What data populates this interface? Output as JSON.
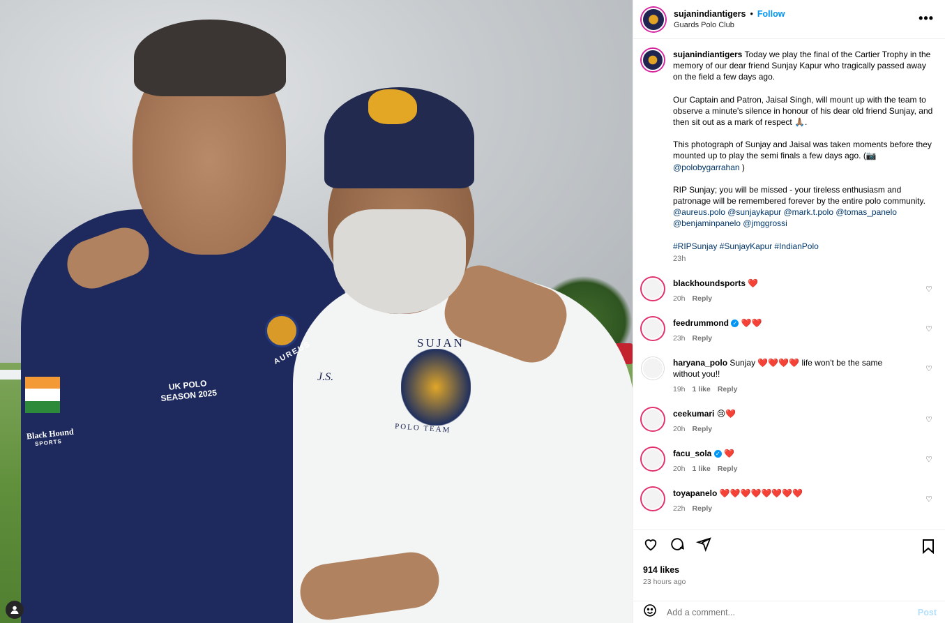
{
  "post": {
    "username": "sujanindiantigers",
    "follow_label": "Follow",
    "location": "Guards Polo Club",
    "more_label": "•••"
  },
  "caption": {
    "username": "sujanindiantigers",
    "p1": "Today we play the final of the Cartier Trophy in the memory of our dear friend Sunjay Kapur who tragically passed away on the field a few days ago.",
    "p2": "Our Captain and Patron, Jaisal Singh, will mount up with the team to observe a minute's silence in honour of his dear old friend Sunjay, and then sit out as a mark of respect 🙏🏽.",
    "p3_text": "This photograph of Sunjay and Jaisal was taken moments before they mounted up to play the semi finals a few days ago. (📷",
    "p3_mention": "@polobygarrahan",
    "p3_end": ")",
    "p4_text": "RIP Sunjay; you will be missed - your tireless enthusiasm and patronage will be remembered forever by the entire polo community.",
    "mentions": [
      "@aureus.polo",
      "@sunjaykapur",
      "@mark.t.polo",
      "@tomas_panelo",
      "@benjaminpanelo",
      "@jmggrossi"
    ],
    "hashtags": "#RIPSunjay #SunjayKapur #IndianPolo",
    "time": "23h"
  },
  "comments": [
    {
      "user": "blackhoundsports",
      "text": "❤️",
      "time": "20h",
      "likes": "",
      "reply": "Reply",
      "verified": false
    },
    {
      "user": "feedrummond",
      "text": "❤️❤️",
      "time": "23h",
      "likes": "",
      "reply": "Reply",
      "verified": true
    },
    {
      "user": "haryana_polo",
      "text": "Sunjay ❤️❤️❤️❤️ life won't be the same without you!!",
      "time": "19h",
      "likes": "1 like",
      "reply": "Reply",
      "verified": false
    },
    {
      "user": "ceekumari",
      "text": "😢❤️",
      "time": "20h",
      "likes": "",
      "reply": "Reply",
      "verified": false
    },
    {
      "user": "facu_sola",
      "text": "❤️",
      "time": "20h",
      "likes": "1 like",
      "reply": "Reply",
      "verified": true
    },
    {
      "user": "toyapanelo",
      "text": "❤️❤️❤️❤️❤️❤️❤️❤️",
      "time": "22h",
      "likes": "",
      "reply": "Reply",
      "verified": false
    }
  ],
  "actions": {
    "likes": "914 likes",
    "ago": "23 hours ago"
  },
  "composer": {
    "placeholder": "Add a comment...",
    "post_label": "Post"
  },
  "photo": {
    "shirt1": "UK POLO SEASON 2025",
    "aureus": "AUREUS",
    "blackhound": "Black Hound",
    "blackhound_sub": "SPORTS",
    "sujay": "SUJAN",
    "initials": "J.S.",
    "polo_team": "POLO TEAM"
  }
}
